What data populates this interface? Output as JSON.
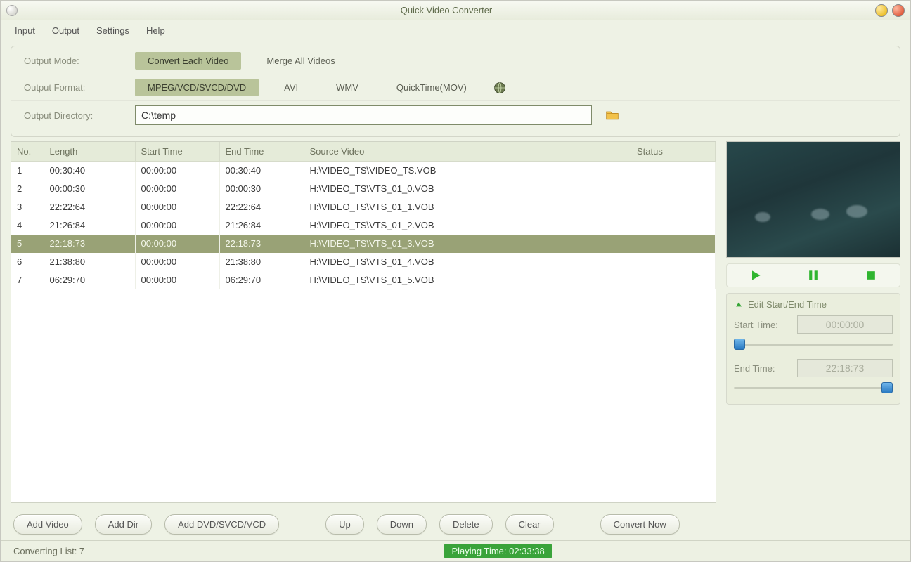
{
  "window": {
    "title": "Quick Video Converter"
  },
  "menu": {
    "input": "Input",
    "output": "Output",
    "settings": "Settings",
    "help": "Help"
  },
  "settings": {
    "output_mode_label": "Output Mode:",
    "mode_convert": "Convert Each Video",
    "mode_merge": "Merge All Videos",
    "output_format_label": "Output Format:",
    "fmt_mpeg": "MPEG/VCD/SVCD/DVD",
    "fmt_avi": "AVI",
    "fmt_wmv": "WMV",
    "fmt_mov": "QuickTime(MOV)",
    "output_directory_label": "Output Directory:",
    "output_directory_value": "C:\\temp"
  },
  "table": {
    "headers": {
      "no": "No.",
      "length": "Length",
      "start": "Start Time",
      "end": "End Time",
      "source": "Source Video",
      "status": "Status"
    },
    "rows": [
      {
        "no": "1",
        "length": "00:30:40",
        "start": "00:00:00",
        "end": "00:30:40",
        "source": "H:\\VIDEO_TS\\VIDEO_TS.VOB",
        "status": ""
      },
      {
        "no": "2",
        "length": "00:00:30",
        "start": "00:00:00",
        "end": "00:00:30",
        "source": "H:\\VIDEO_TS\\VTS_01_0.VOB",
        "status": ""
      },
      {
        "no": "3",
        "length": "22:22:64",
        "start": "00:00:00",
        "end": "22:22:64",
        "source": "H:\\VIDEO_TS\\VTS_01_1.VOB",
        "status": ""
      },
      {
        "no": "4",
        "length": "21:26:84",
        "start": "00:00:00",
        "end": "21:26:84",
        "source": "H:\\VIDEO_TS\\VTS_01_2.VOB",
        "status": ""
      },
      {
        "no": "5",
        "length": "22:18:73",
        "start": "00:00:00",
        "end": "22:18:73",
        "source": "H:\\VIDEO_TS\\VTS_01_3.VOB",
        "status": ""
      },
      {
        "no": "6",
        "length": "21:38:80",
        "start": "00:00:00",
        "end": "21:38:80",
        "source": "H:\\VIDEO_TS\\VTS_01_4.VOB",
        "status": ""
      },
      {
        "no": "7",
        "length": "06:29:70",
        "start": "00:00:00",
        "end": "06:29:70",
        "source": "H:\\VIDEO_TS\\VTS_01_5.VOB",
        "status": ""
      }
    ],
    "selected_index": 4
  },
  "preview": {
    "edit_hdr": "Edit Start/End Time",
    "start_label": "Start Time:",
    "start_value": "00:00:00",
    "end_label": "End Time:",
    "end_value": "22:18:73"
  },
  "buttons": {
    "add_video": "Add Video",
    "add_dir": "Add Dir",
    "add_disc": "Add DVD/SVCD/VCD",
    "up": "Up",
    "down": "Down",
    "delete": "Delete",
    "clear": "Clear",
    "convert": "Convert Now"
  },
  "status": {
    "list_count": "Converting List: 7",
    "playing": "Playing Time: 02:33:38"
  }
}
